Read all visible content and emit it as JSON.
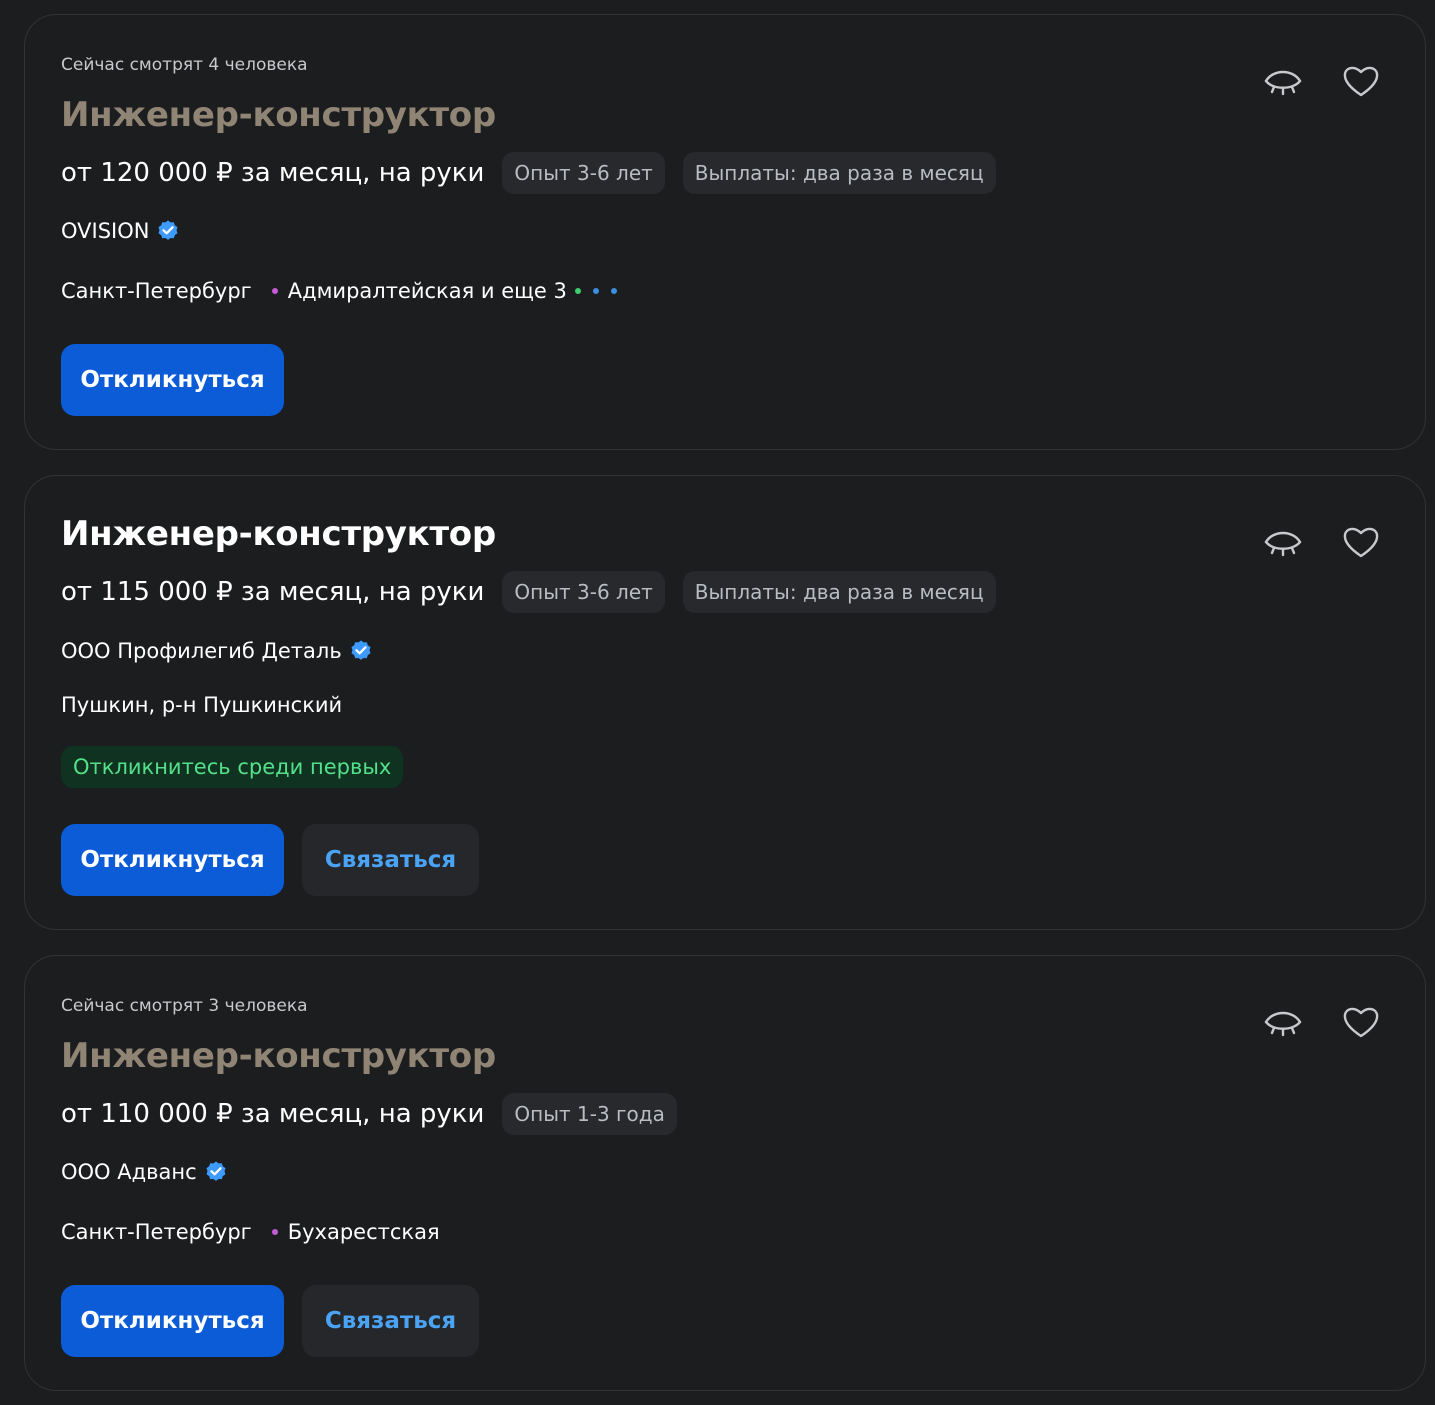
{
  "colors": {
    "background": "#1c1d1f",
    "card_border": "#303236",
    "visited_title": "#908575",
    "primary_button": "#0b5cd6",
    "secondary_button_text": "#4ba3f5",
    "badge_bg": "#0f3320",
    "badge_text": "#54e08a",
    "verified": "#3d9bff"
  },
  "vacancies": [
    {
      "viewers": "Сейчас смотрят 4 человека",
      "title": "Инженер-конструктор",
      "salary": "от 120 000 ₽ за месяц, на руки",
      "tags": [
        "Опыт 3-6 лет",
        "Выплаты: два раза в месяц"
      ],
      "company": "OVISION",
      "city": "Санкт-Петербург",
      "metro": "Адмиралтейская и еще 3",
      "metro_line_color": "#c65bd6",
      "extra_line_colors": [
        "#3fcf6e",
        "#3b8ee0",
        "#3b8ee0"
      ],
      "respond_label": "Откликнуться",
      "hide_icon": "closed-eye-icon",
      "favorite_icon": "heart-icon"
    },
    {
      "title": "Инженер-конструктор",
      "salary": "от 115 000 ₽ за месяц, на руки",
      "tags": [
        "Опыт 3-6 лет",
        "Выплаты: два раза в месяц"
      ],
      "company": "ООО Профилегиб Деталь",
      "location": "Пушкин, р-н Пушкинский",
      "badge": "Откликнитесь среди первых",
      "respond_label": "Откликнуться",
      "contact_label": "Связаться",
      "hide_icon": "closed-eye-icon",
      "favorite_icon": "heart-icon"
    },
    {
      "viewers": "Сейчас смотрят 3 человека",
      "title": "Инженер-конструктор",
      "salary": "от 110 000 ₽ за месяц, на руки",
      "tags": [
        "Опыт 1-3 года"
      ],
      "company": "ООО Адванс",
      "city": "Санкт-Петербург",
      "metro": "Бухарестская",
      "metro_line_color": "#c65bd6",
      "respond_label": "Откликнуться",
      "contact_label": "Связаться",
      "hide_icon": "closed-eye-icon",
      "favorite_icon": "heart-icon"
    }
  ]
}
